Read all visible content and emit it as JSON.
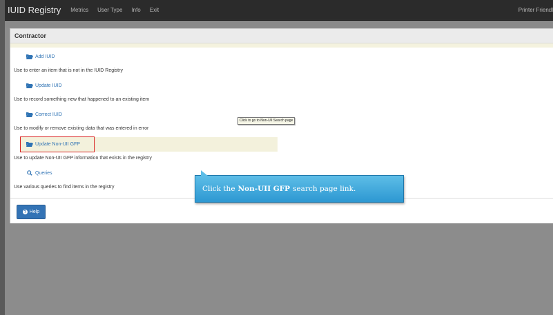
{
  "navbar": {
    "brand": "IUID Registry",
    "links": [
      "Metrics",
      "User Type",
      "Info",
      "Exit"
    ],
    "printer_friendly": "Printer Friendl"
  },
  "panel": {
    "title": "Contractor",
    "items": [
      {
        "link": "Add IUID",
        "icon": "folder-open-icon",
        "description": "Use to enter an item that is not in the IUID Registry"
      },
      {
        "link": "Update IUID",
        "icon": "folder-open-icon",
        "description": "Use to record something new that happened to an existing item"
      },
      {
        "link": "Correct IUID",
        "icon": "folder-open-icon",
        "description": "Use to modify or remove existing data that was entered in error"
      },
      {
        "link": "Update Non-UII GFP",
        "icon": "folder-open-icon",
        "description": "Use to update Non-UII GFP information that exists in the registry"
      },
      {
        "link": "Queries",
        "icon": "search-icon",
        "description": "Use various queries to find items in the registry"
      }
    ],
    "help_label": "Help"
  },
  "tooltip": "Click to go to Non-UII Search page",
  "callout": {
    "prefix": "Click the",
    "bold": "Non-UII GFP",
    "suffix": "search page link."
  },
  "colors": {
    "link": "#2f73b4",
    "button": "#3373b5",
    "callout": "#2d98d2",
    "highlight_border": "#d92020"
  }
}
